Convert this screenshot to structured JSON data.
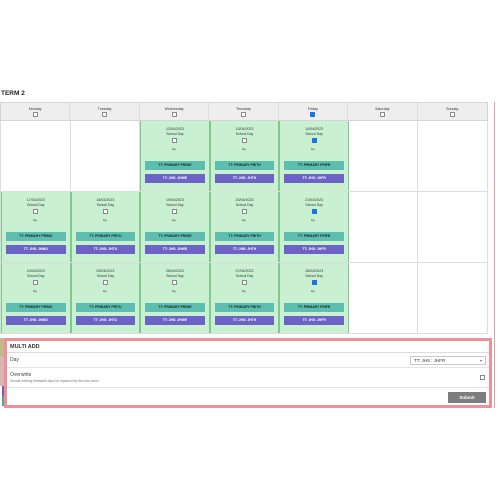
{
  "term_title": "TERM 2",
  "weekdays": [
    {
      "label": "Monday",
      "checked": false
    },
    {
      "label": "Tuesday",
      "checked": false
    },
    {
      "label": "Wednesday",
      "checked": false
    },
    {
      "label": "Thursday",
      "checked": false
    },
    {
      "label": "Friday",
      "checked": true
    },
    {
      "label": "Saturday",
      "checked": false
    },
    {
      "label": "Sunday",
      "checked": false
    }
  ],
  "weeks": [
    [
      null,
      null,
      {
        "date": "12/04/2023",
        "type": "School Day",
        "checked": false,
        "bar1": "TT: PRIMARY PRIWE",
        "bar2": "TT: JHS: JHWE"
      },
      {
        "date": "13/04/2023",
        "type": "School Day",
        "checked": false,
        "bar1": "TT: PRIMARY PRITH",
        "bar2": "TT: JHS: JHTH"
      },
      {
        "date": "14/04/2023",
        "type": "School Day",
        "checked": true,
        "bar1": "TT: PRIMARY PRIFR",
        "bar2": "TT: JHS: JHFR"
      },
      null,
      null
    ],
    [
      {
        "date": "17/04/2023",
        "type": "School Day",
        "checked": false,
        "bar1": "TT: PRIMARY PRIMO",
        "bar2": "TT: JHS: JHMO"
      },
      {
        "date": "18/04/2023",
        "type": "School Day",
        "checked": false,
        "bar1": "TT: PRIMARY PRITU",
        "bar2": "TT: JHS: JHTU"
      },
      {
        "date": "19/04/2023",
        "type": "School Day",
        "checked": false,
        "bar1": "TT: PRIMARY PRIWE",
        "bar2": "TT: JHS: JHWE"
      },
      {
        "date": "20/04/2023",
        "type": "School Day",
        "checked": false,
        "bar1": "TT: PRIMARY PRITH",
        "bar2": "TT: JHS: JHTH"
      },
      {
        "date": "21/04/2023",
        "type": "School Day",
        "checked": true,
        "bar1": "TT: PRIMARY PRIFR",
        "bar2": "TT: JHS: JHFR"
      },
      null,
      null
    ],
    [
      {
        "date": "24/04/2023",
        "type": "School Day",
        "checked": false,
        "bar1": "TT: PRIMARY PRIMO",
        "bar2": "TT: JHS: JHMO"
      },
      {
        "date": "25/04/2023",
        "type": "School Day",
        "checked": false,
        "bar1": "TT: PRIMARY PRITU",
        "bar2": "TT: JHS: JHTU"
      },
      {
        "date": "26/04/2023",
        "type": "School Day",
        "checked": false,
        "bar1": "TT: PRIMARY PRIWE",
        "bar2": "TT: JHS: JHWE"
      },
      {
        "date": "27/04/2023",
        "type": "School Day",
        "checked": false,
        "bar1": "TT: PRIMARY PRITH",
        "bar2": "TT: JHS: JHTH"
      },
      {
        "date": "28/04/2023",
        "type": "School Day",
        "checked": true,
        "bar1": "TT: PRIMARY PRIFR",
        "bar2": "TT: JHS: JHFR"
      },
      null,
      null
    ]
  ],
  "multi_add": {
    "title": "MULTI ADD",
    "day_label": "Day",
    "day_value": "TT: JHS : JHFR",
    "overwrite_label": "Overwrite",
    "overwrite_help": "Should existing timetable days be replaced by the new ones?",
    "submit_label": "Submit"
  },
  "colors": {
    "school_day": "#c8f0d1",
    "bar_primary": "#5dbdaf",
    "bar_jhs": "#6b64c6",
    "highlight_border": "#f08f97",
    "checkbox_checked": "#1f73e0"
  },
  "icons": {
    "edit": "pencil-icon",
    "select_caret": "chevron-down-icon"
  }
}
